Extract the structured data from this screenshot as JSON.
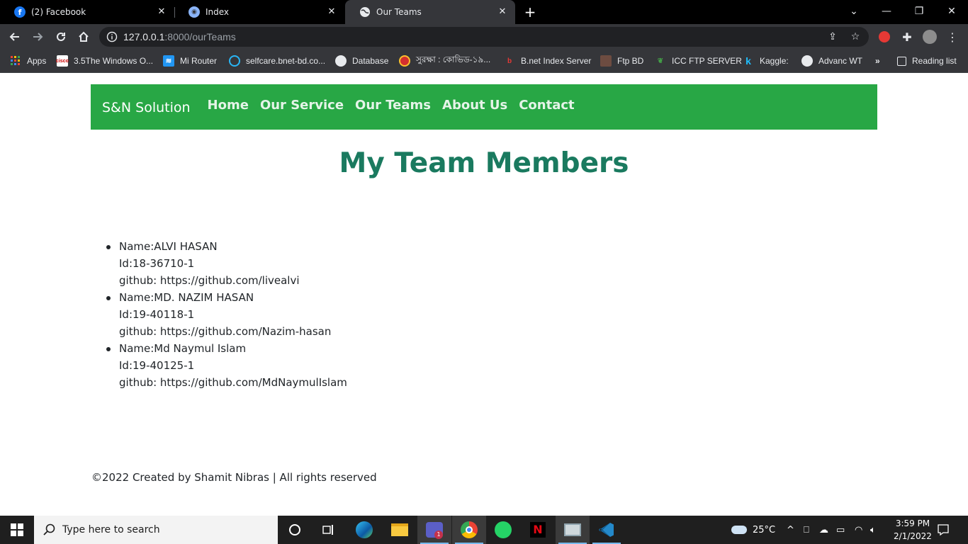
{
  "browser": {
    "tabs": [
      {
        "label": "(2) Facebook",
        "icon": "facebook-icon"
      },
      {
        "label": "Index",
        "icon": "globe-shield-icon"
      },
      {
        "label": "Our Teams",
        "icon": "globe-icon",
        "active": true
      }
    ],
    "url_host": "127.0.0.1",
    "url_path": ":8000/ourTeams",
    "bookmarks": [
      {
        "label": "Apps",
        "icon": "apps-grid-icon"
      },
      {
        "label": "3.5The Windows O...",
        "icon": "cisco-icon"
      },
      {
        "label": "Mi Router",
        "icon": "wifi-icon"
      },
      {
        "label": "selfcare.bnet-bd.co...",
        "icon": "target-icon"
      },
      {
        "label": "Database",
        "icon": "globe-icon"
      },
      {
        "label": "সুরক্ষা : কোভিড-১৯...",
        "icon": "seal-icon"
      },
      {
        "label": "B.net Index Server",
        "icon": "bnet-icon"
      },
      {
        "label": "Ftp BD",
        "icon": "ftp-icon"
      },
      {
        "label": "ICC FTP SERVER",
        "icon": "leaf-icon"
      },
      {
        "label": "Kaggle:",
        "icon": "kaggle-icon"
      },
      {
        "label": "Advanc WT",
        "icon": "globe-icon"
      }
    ],
    "more_bookmarks": "»",
    "reading_list": "Reading list"
  },
  "site": {
    "brand": "S&N Solution",
    "nav": [
      "Home",
      "Our Service",
      "Our Teams",
      "About Us",
      "Contact"
    ],
    "heading": "My Team Members",
    "members": [
      {
        "name": "Name:ALVI HASAN",
        "id": "Id:18-36710-1",
        "github": "github: https://github.com/livealvi"
      },
      {
        "name": "Name:MD. NAZIM HASAN",
        "id": "Id:19-40118-1",
        "github": "github: https://github.com/Nazim-hasan"
      },
      {
        "name": "Name:Md Naymul Islam",
        "id": "Id:19-40125-1",
        "github": "github: https://github.com/MdNaymulIslam"
      }
    ],
    "footer": "©2022 Created by Shamit Nibras | All rights reserved",
    "colors": {
      "navbar": "#28a745",
      "heading": "#1a7a5f"
    }
  },
  "taskbar": {
    "search_placeholder": "Type here to search",
    "weather": "25°C",
    "time": "3:59 PM",
    "date": "2/1/2022",
    "teams_badge": "1"
  }
}
